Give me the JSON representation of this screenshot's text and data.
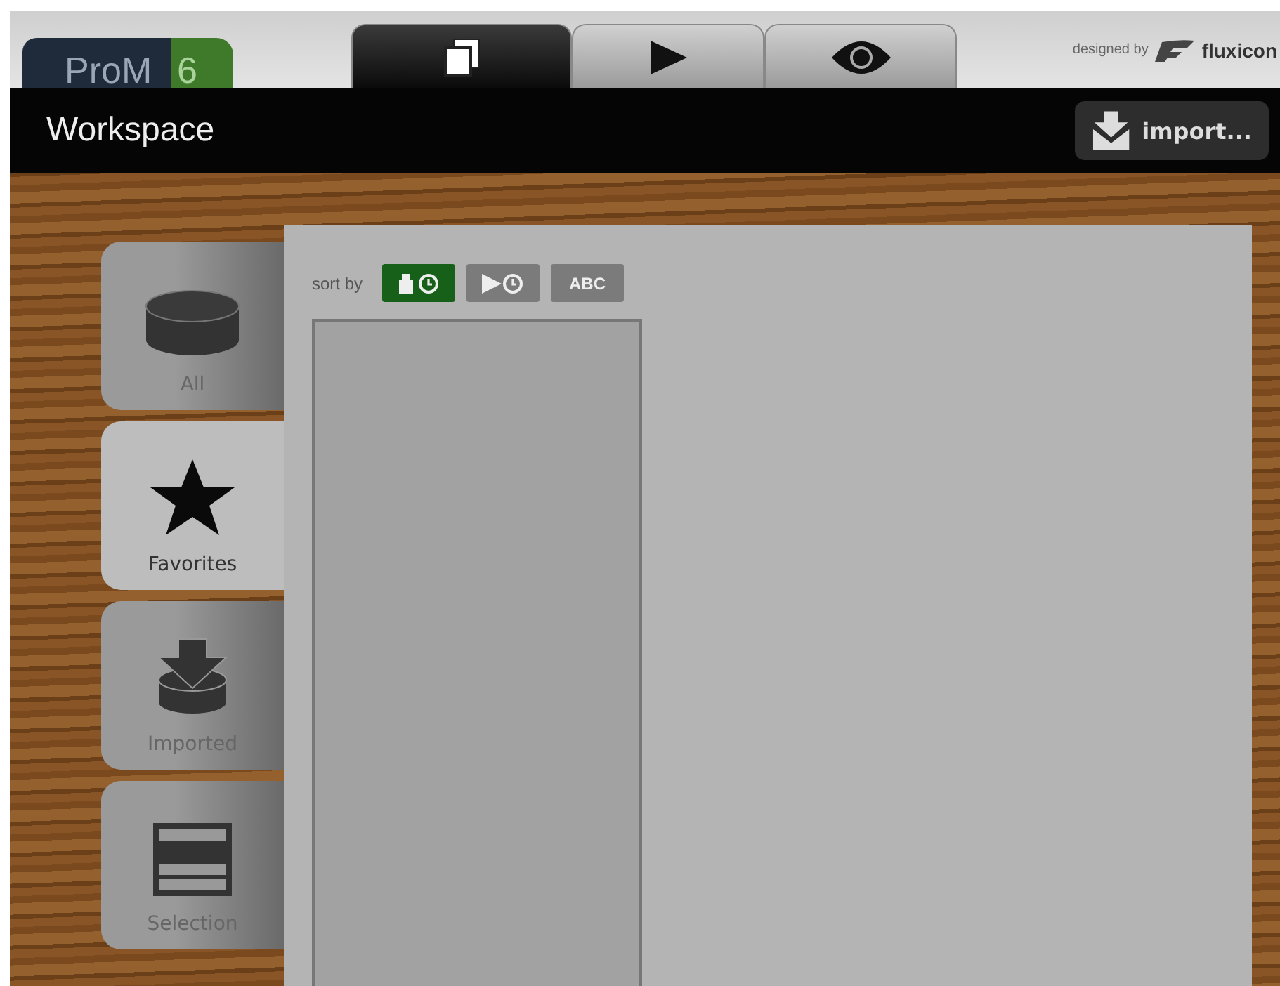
{
  "logo": {
    "name": "ProM",
    "version": "6"
  },
  "main_tabs": [
    {
      "kind": "workspace",
      "selected": true
    },
    {
      "kind": "action",
      "selected": false
    },
    {
      "kind": "view",
      "selected": false
    }
  ],
  "credit": {
    "label": "designed by",
    "brand": "fluxicon"
  },
  "title": "Workspace",
  "import_button": "import...",
  "sidebar": [
    {
      "kind": "all",
      "label": "All",
      "selected": false
    },
    {
      "kind": "favorites",
      "label": "Favorites",
      "selected": true
    },
    {
      "kind": "imported",
      "label": "Imported",
      "selected": false
    },
    {
      "kind": "selection",
      "label": "Selection",
      "selected": false
    }
  ],
  "sort": {
    "label": "sort by",
    "options": [
      {
        "kind": "created",
        "selected": true
      },
      {
        "kind": "used",
        "selected": false
      },
      {
        "kind": "alpha",
        "label": "ABC",
        "selected": false
      }
    ]
  }
}
